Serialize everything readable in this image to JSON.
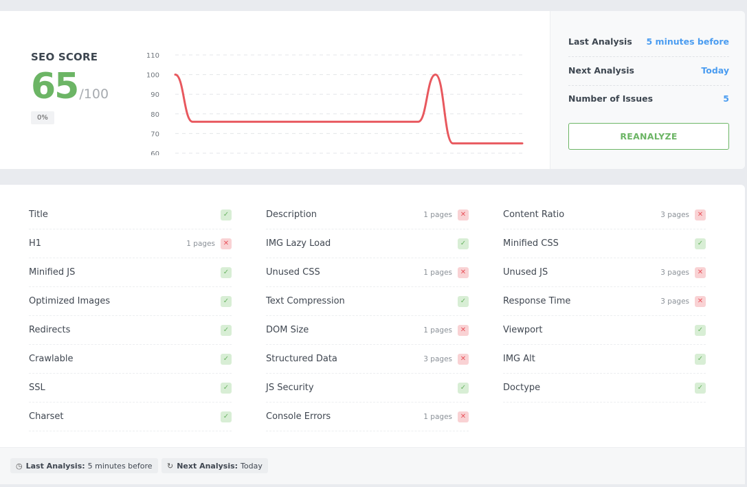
{
  "score": {
    "title": "SEO SCORE",
    "value": "65",
    "max": "/100",
    "change": "0%",
    "accent_color": "#6cb565"
  },
  "chart_data": {
    "type": "line",
    "title": "",
    "xlabel": "",
    "ylabel": "",
    "ylim": [
      60,
      110
    ],
    "y_ticks": [
      60,
      70,
      80,
      90,
      100,
      110
    ],
    "grid": true,
    "series": [
      {
        "name": "SEO Score",
        "color": "#e8585e",
        "values": [
          100,
          76,
          76,
          76,
          76,
          76,
          76,
          76,
          76,
          76,
          76,
          76,
          76,
          76,
          76,
          100,
          65,
          65,
          65,
          65,
          65
        ]
      }
    ]
  },
  "stats": {
    "last_analysis_label": "Last Analysis",
    "last_analysis_value": "5 minutes before",
    "next_analysis_label": "Next Analysis",
    "next_analysis_value": "Today",
    "issues_label": "Number of Issues",
    "issues_value": "5",
    "reanalyze_label": "REANALYZE"
  },
  "checks": {
    "columns": [
      [
        {
          "label": "Title",
          "status": "pass",
          "pages": ""
        },
        {
          "label": "H1",
          "status": "fail",
          "pages": "1 pages"
        },
        {
          "label": "Minified JS",
          "status": "pass",
          "pages": ""
        },
        {
          "label": "Optimized Images",
          "status": "pass",
          "pages": ""
        },
        {
          "label": "Redirects",
          "status": "pass",
          "pages": ""
        },
        {
          "label": "Crawlable",
          "status": "pass",
          "pages": ""
        },
        {
          "label": "SSL",
          "status": "pass",
          "pages": ""
        },
        {
          "label": "Charset",
          "status": "pass",
          "pages": ""
        }
      ],
      [
        {
          "label": "Description",
          "status": "fail",
          "pages": "1 pages"
        },
        {
          "label": "IMG Lazy Load",
          "status": "pass",
          "pages": ""
        },
        {
          "label": "Unused CSS",
          "status": "fail",
          "pages": "1 pages"
        },
        {
          "label": "Text Compression",
          "status": "pass",
          "pages": ""
        },
        {
          "label": "DOM Size",
          "status": "fail",
          "pages": "1 pages"
        },
        {
          "label": "Structured Data",
          "status": "fail",
          "pages": "3 pages"
        },
        {
          "label": "JS Security",
          "status": "pass",
          "pages": ""
        },
        {
          "label": "Console Errors",
          "status": "fail",
          "pages": "1 pages"
        }
      ],
      [
        {
          "label": "Content Ratio",
          "status": "fail",
          "pages": "3 pages"
        },
        {
          "label": "Minified CSS",
          "status": "pass",
          "pages": ""
        },
        {
          "label": "Unused JS",
          "status": "fail",
          "pages": "3 pages"
        },
        {
          "label": "Response Time",
          "status": "fail",
          "pages": "3 pages"
        },
        {
          "label": "Viewport",
          "status": "pass",
          "pages": ""
        },
        {
          "label": "IMG Alt",
          "status": "pass",
          "pages": ""
        },
        {
          "label": "Doctype",
          "status": "pass",
          "pages": ""
        }
      ]
    ],
    "pass_icon": "check-icon",
    "fail_icon": "x-icon"
  },
  "footer": {
    "last_icon": "clock-icon",
    "last_label": "Last Analysis:",
    "last_value": "5 minutes before",
    "next_icon": "refresh-icon",
    "next_label": "Next Analysis:",
    "next_value": "Today"
  }
}
